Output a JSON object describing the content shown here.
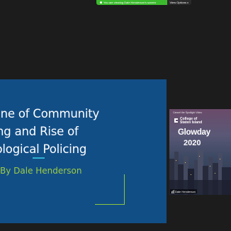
{
  "banner": {
    "sharing_text": "You are viewing Dale Henderson's screen",
    "view_options_label": "View Options",
    "view_options_chevron": "v"
  },
  "slide": {
    "title": "ecline of Community\nlicing and Rise of\nnnological Policing",
    "author": "By Dale Henderson",
    "colors": {
      "background": "#124e86",
      "accent_rule": "#2fb0d0",
      "corner_accent": "#8cc63f",
      "author_text": "#9ccc44"
    }
  },
  "video_tile": {
    "caption_top": "Cancel the Spotlight Video",
    "logo_text": "College of\nStaten Island",
    "event_title": "Glowday",
    "event_year": "2020",
    "participant_name": "Dale Henderson",
    "icons": [
      "csi-logo-icon",
      "mic-icon"
    ]
  },
  "share_icon": "share-dot-icon"
}
